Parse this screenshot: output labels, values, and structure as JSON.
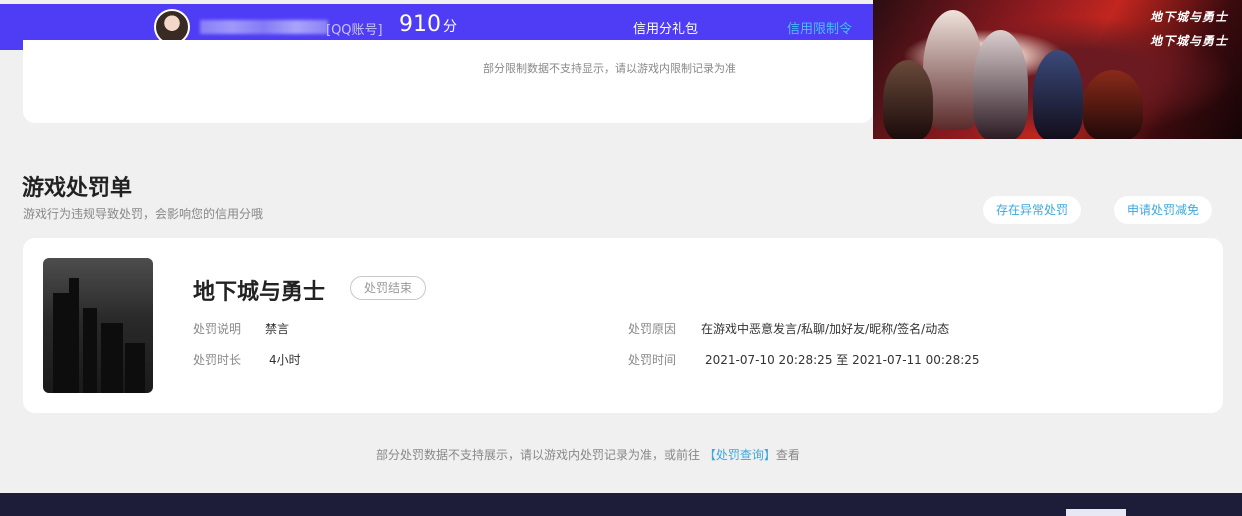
{
  "topbar": {
    "account_type": "[QQ账号]",
    "score": "910",
    "score_unit": "分",
    "nav": [
      {
        "label": "信用分礼包",
        "active": false
      },
      {
        "label": "信用限制令",
        "active": true
      }
    ]
  },
  "banner": {
    "logo_top": "地下城与勇士",
    "logo_bottom": "地下城与勇士"
  },
  "restriction_card": {
    "note": "部分限制数据不支持显示，请以游戏内限制记录为准"
  },
  "penalty_section": {
    "title": "游戏处罚单",
    "subtitle": "游戏行为违规导致处罚，会影响您的信用分哦",
    "buttons": {
      "report_abnormal": "存在异常处罚",
      "apply_reduction": "申请处罚减免"
    }
  },
  "penalty": {
    "game_name": "地下城与勇士",
    "status": "处罚结束",
    "fields": {
      "desc_label": "处罚说明",
      "desc_value": "禁言",
      "duration_label": "处罚时长",
      "duration_value": "4小时",
      "reason_label": "处罚原因",
      "reason_value": "在游戏中恶意发言/私聊/加好友/昵称/签名/动态",
      "time_label": "处罚时间",
      "time_value": "2021-07-10 20:28:25 至 2021-07-11 00:28:25"
    }
  },
  "footer_note": {
    "text_before": "部分处罚数据不支持展示，请以游戏内处罚记录为准，或前往",
    "link": "【处罚查询】",
    "text_after": "查看"
  },
  "colors": {
    "topbar": "#4f3cf5",
    "accent": "#48c0f8",
    "link": "#3ba8e0",
    "background": "#f0f0f0",
    "footer": "#1d1d3a"
  }
}
